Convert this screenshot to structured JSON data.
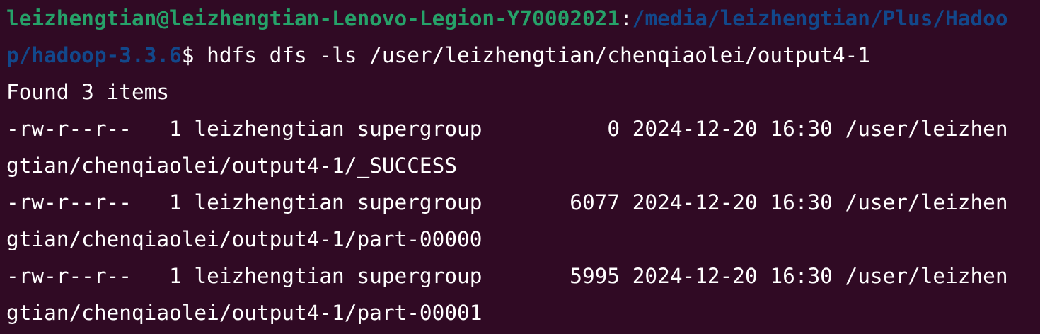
{
  "terminal": {
    "prompt": {
      "user_host": "leizhengtian@leizhengtian-Lenovo-Legion-Y70002021",
      "separator": ":",
      "path_line1": "/media/leizhengtian/Plus/Hadoo",
      "path_line2": "p/hadoop-3.3.6",
      "symbol": "$ ",
      "command": "hdfs dfs -ls /user/leizhengtian/chenqiaolei/output4-1"
    },
    "found": "Found 3 items",
    "entries": [
      {
        "line1": "-rw-r--r--   1 leizhengtian supergroup          0 2024-12-20 16:30 /user/leizhen",
        "line2": "gtian/chenqiaolei/output4-1/_SUCCESS"
      },
      {
        "line1": "-rw-r--r--   1 leizhengtian supergroup       6077 2024-12-20 16:30 /user/leizhen",
        "line2": "gtian/chenqiaolei/output4-1/part-00000"
      },
      {
        "line1": "-rw-r--r--   1 leizhengtian supergroup       5995 2024-12-20 16:30 /user/leizhen",
        "line2": "gtian/chenqiaolei/output4-1/part-00001"
      }
    ],
    "colors": {
      "background": "#300a24",
      "user_host": "#26a269",
      "path": "#12488b",
      "text": "#ffffff"
    }
  }
}
